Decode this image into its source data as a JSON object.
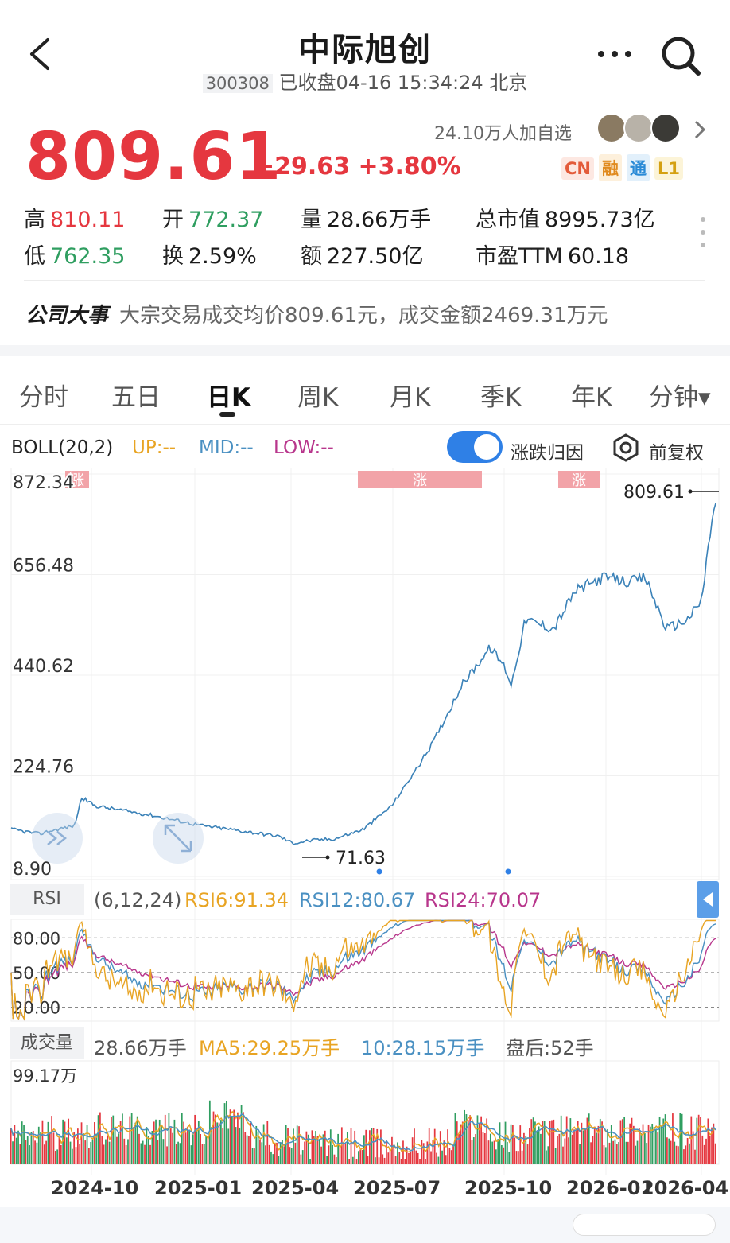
{
  "header": {
    "title": "中际旭创",
    "code": "300308",
    "status": "已收盘04-16 15:34:24 北京"
  },
  "quote": {
    "price": "809.61",
    "change": "+29.63 +3.80%",
    "followers": "24.10万人加自选",
    "badges": [
      "CN",
      "融",
      "通",
      "L1"
    ],
    "stats": {
      "high_label": "高",
      "high": "810.11",
      "open_label": "开",
      "open": "772.37",
      "volume_label": "量",
      "volume": "28.66万手",
      "mktcap_label": "总市值",
      "mktcap": "8995.73亿",
      "low_label": "低",
      "low": "762.35",
      "turnover_label": "换",
      "turnover": "2.59%",
      "amount_label": "额",
      "amount": "227.50亿",
      "pe_label": "市盈TTM",
      "pe": "60.18"
    },
    "event_label": "公司大事",
    "event_text": "大宗交易成交均价809.61元，成交金额2469.31万元"
  },
  "tabs": [
    "分时",
    "五日",
    "日K",
    "周K",
    "月K",
    "季K",
    "年K",
    "分钟▾"
  ],
  "active_tab": "日K",
  "indicator_bar": {
    "name": "BOLL(20,2)",
    "up": "UP:--",
    "mid": "MID:--",
    "low": "LOW:--",
    "toggle_label": "涨跌归因",
    "adjust_label": "前复权"
  },
  "price_chart": {
    "y_ticks": [
      "872.34",
      "656.48",
      "440.62",
      "224.76",
      "8.90"
    ],
    "last_label": "809.61",
    "min_label": "71.63",
    "tags": [
      "涨",
      "涨",
      "涨"
    ],
    "line_color": "#3b82b8"
  },
  "rsi": {
    "button": "RSI",
    "params": "(6,12,24)",
    "rsi6": "RSI6:91.34",
    "rsi12": "RSI12:80.67",
    "rsi24": "RSI24:70.07",
    "y_ticks": [
      "80.00",
      "50.00",
      "20.00"
    ],
    "colors": {
      "rsi6": "#e8a423",
      "rsi12": "#4a90c2",
      "rsi24": "#b8368c"
    }
  },
  "volume": {
    "button": "成交量",
    "value": "28.66万手",
    "ma5": "MA5:29.25万手",
    "ma10": "10:28.15万手",
    "after_hours": "盘后:52手",
    "y_top": "99.17万",
    "up_color": "#e5373f",
    "down_color": "#2f9e60"
  },
  "x_ticks": [
    "2024-10",
    "2025-01",
    "2025-04",
    "2025-07",
    "2025-10",
    "2026-01",
    "2026-04"
  ],
  "chart_data": {
    "type": "line",
    "title": "",
    "x": [
      "2024-10",
      "2025-01",
      "2025-04",
      "2025-07",
      "2025-10",
      "2026-01",
      "2026-04"
    ],
    "series": [
      {
        "values": [
          125,
          85,
          80,
          150,
          470,
          600,
          809.61
        ]
      }
    ],
    "ylim": [
      8.9,
      872.34
    ],
    "annotations": [
      "71.63",
      "809.61"
    ]
  }
}
